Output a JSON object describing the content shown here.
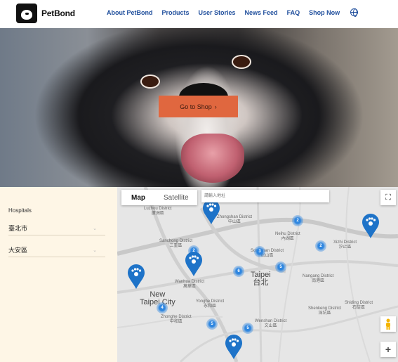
{
  "nav": {
    "brand": "PetBond",
    "links": [
      "About PetBond",
      "Products",
      "User Stories",
      "News Feed",
      "FAQ",
      "Shop Now"
    ]
  },
  "hero": {
    "cta_label": "Go to Shop",
    "cta_arrow": "›"
  },
  "sidebar": {
    "title": "Hospitals",
    "city": "臺北市",
    "district": "大安區",
    "chevron": "⌄"
  },
  "map": {
    "map_label": "Map",
    "satellite_label": "Satellite",
    "search_placeholder": "請輸入地址",
    "fullscreen_icon": "⛶",
    "zoom_in": "+",
    "clusters": [
      "2",
      "2",
      "2",
      "3",
      "6",
      "5",
      "4",
      "5",
      "5"
    ],
    "labels": {
      "luzhou": "Luzhou District\n蘆洲區",
      "zhongshan": "Zhongshan District\n中山區",
      "neihu": "Neihu District\n內湖區",
      "xizhi": "Xizhi District\n汐止區",
      "sanchong": "Sanchong District\n三重區",
      "songshan": "Songshan District\n松山區",
      "taipei": "Taipei\n台北",
      "new_taipei": "New\nTaipei City",
      "wanhua": "Wanhua District\n萬華區",
      "nangang": "Nangang District\n南港區",
      "yonghe": "Yonghe District\n永和區",
      "zhonghe": "Zhonghe District\n中和區",
      "shenkeng": "Shenkeng District\n深坑區",
      "shiding": "Shiding District\n石碇區",
      "wenshan": "Wenshan District\n文山區"
    }
  },
  "colors": {
    "brand_blue": "#1f4e9c",
    "cta": "#e0673f",
    "sidebar_bg": "#fef6e6",
    "pin": "#1e73c8"
  }
}
